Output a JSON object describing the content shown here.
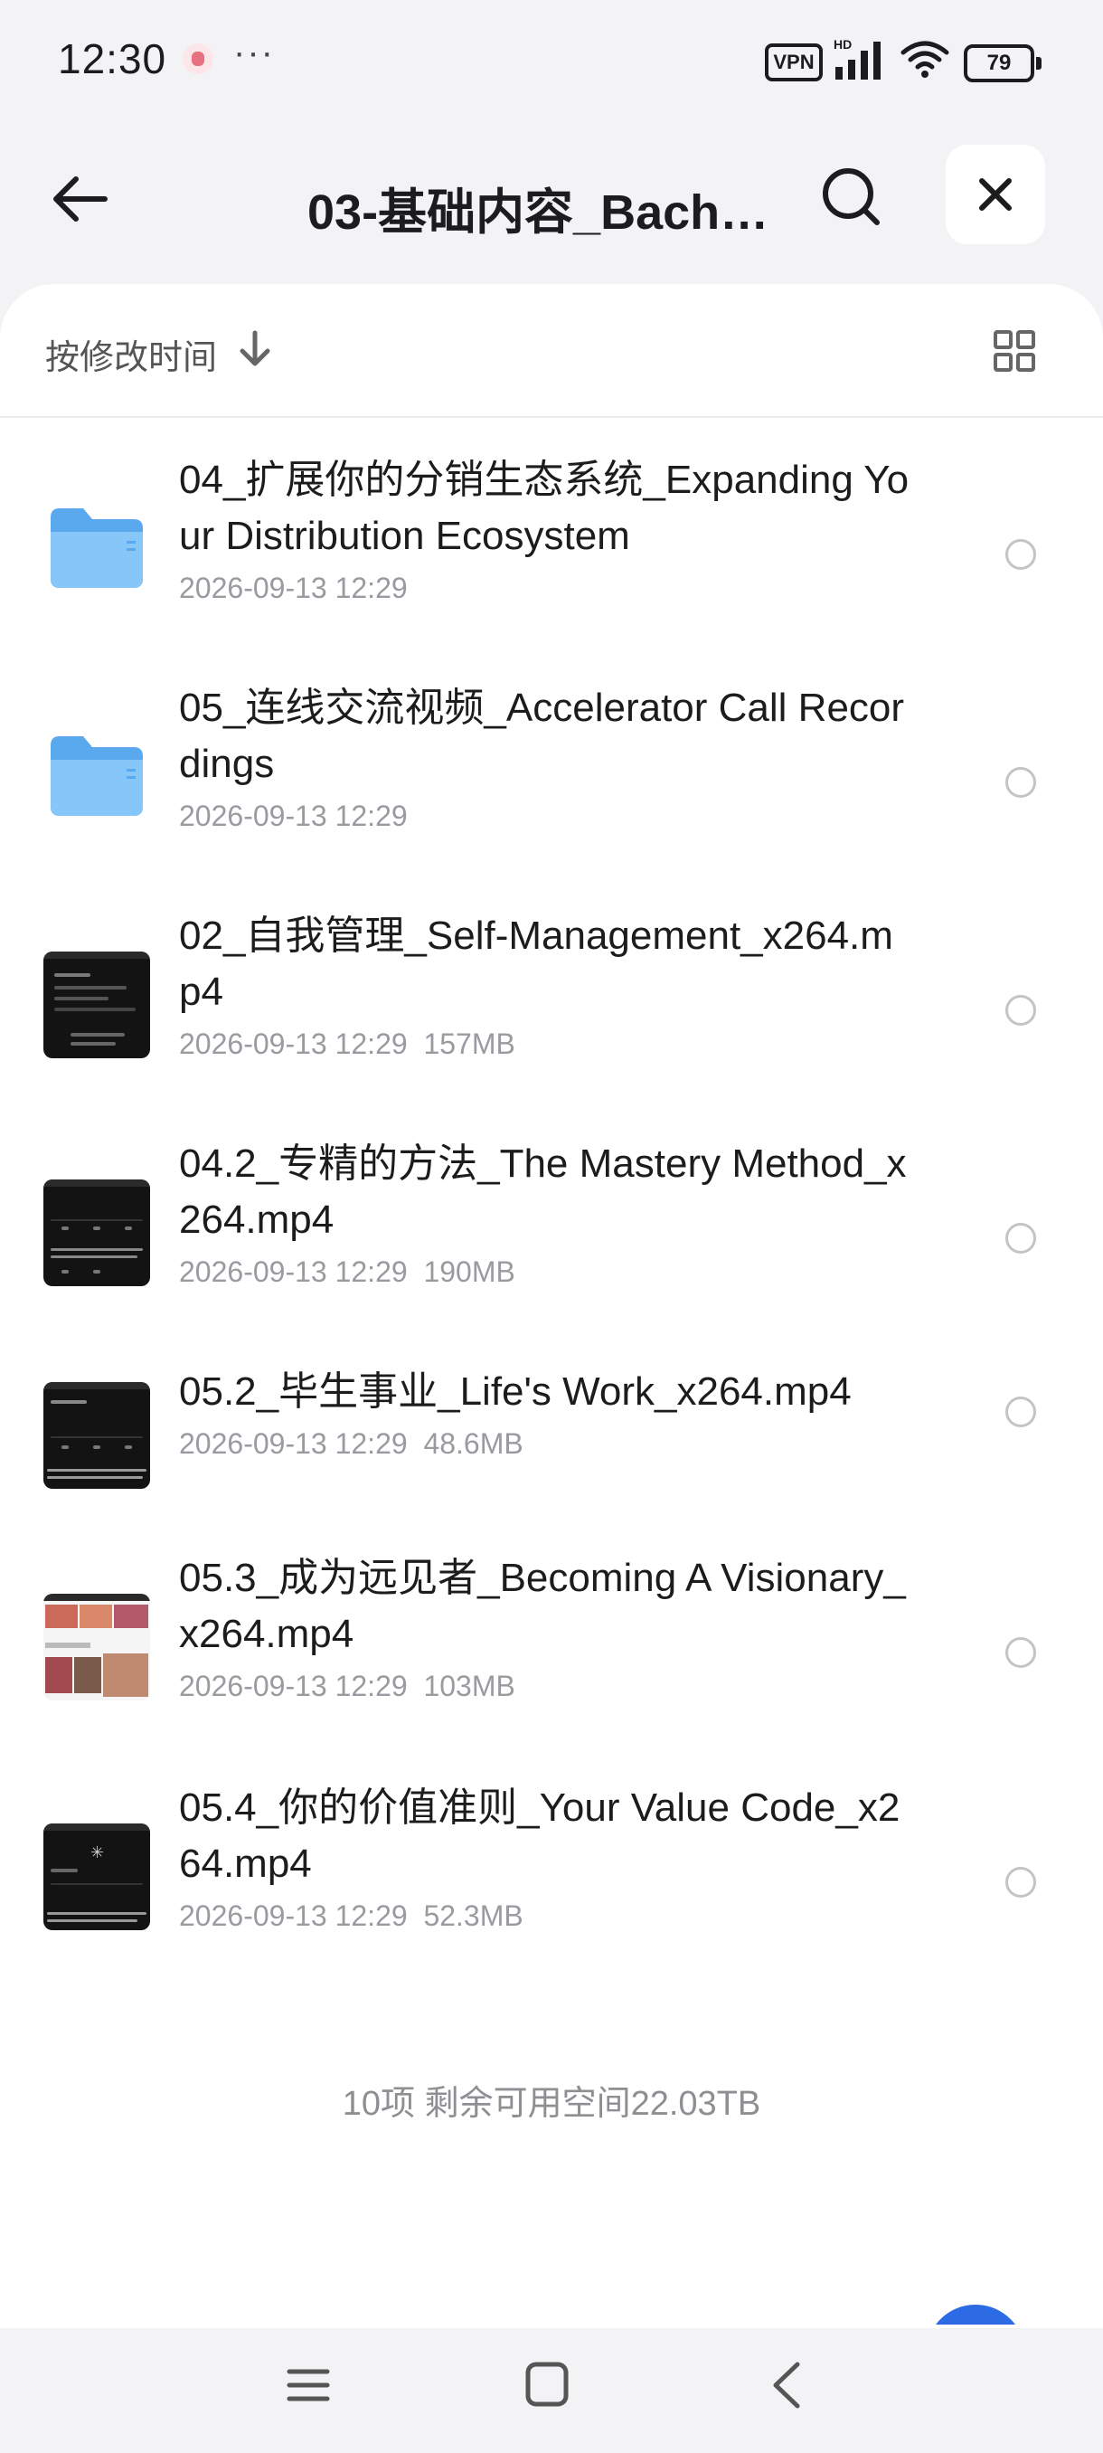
{
  "status_bar": {
    "time": "12:30",
    "more": "···",
    "vpn": "VPN",
    "hd": "HD",
    "battery": "79"
  },
  "header": {
    "title": "03-基础内容_Bache…",
    "back_icon": "arrow-left-icon",
    "search_icon": "search-icon",
    "close_icon": "close-icon"
  },
  "sort_bar": {
    "label": "按修改时间",
    "sort_icon": "arrow-down-icon",
    "view_icon": "grid-view-icon"
  },
  "files": [
    {
      "name": "04_扩展你的分销生态系统_Expanding Your Distribution Ecosystem",
      "date": "2026-09-13 12:29",
      "size": "",
      "type": "folder"
    },
    {
      "name": "05_连线交流视频_Accelerator Call Recordings",
      "date": "2026-09-13 12:29",
      "size": "",
      "type": "folder"
    },
    {
      "name": "02_自我管理_Self-Management_x264.mp4",
      "date": "2026-09-13 12:29",
      "size": "157MB",
      "type": "video"
    },
    {
      "name": "04.2_专精的方法_The Mastery Method_x264.mp4",
      "date": "2026-09-13 12:29",
      "size": "190MB",
      "type": "video"
    },
    {
      "name": "05.2_毕生事业_Life's Work_x264.mp4",
      "date": "2026-09-13 12:29",
      "size": "48.6MB",
      "type": "video"
    },
    {
      "name": "05.3_成为远见者_Becoming A Visionary_x264.mp4",
      "date": "2026-09-13 12:29",
      "size": "103MB",
      "type": "video"
    },
    {
      "name": "05.4_你的价值准则_Your Value Code_x264.mp4",
      "date": "2026-09-13 12:29",
      "size": "52.3MB",
      "type": "video"
    }
  ],
  "footer": {
    "summary": "10项 剩余可用空间22.03TB"
  },
  "nav_bar": {
    "menu_icon": "menu-icon",
    "home_icon": "home-square-icon",
    "back_icon": "chevron-left-icon"
  },
  "colors": {
    "background": "#f3f3f5",
    "card": "#ffffff",
    "folder": "#6fb8f5",
    "fab": "#2d6be4"
  }
}
